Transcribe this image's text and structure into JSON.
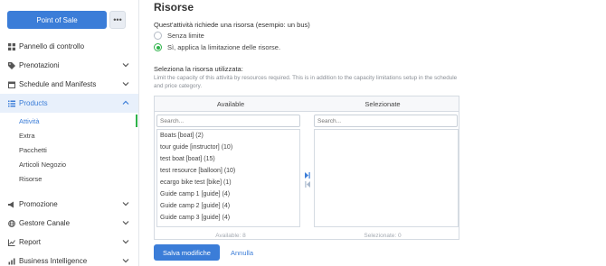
{
  "sidebar": {
    "pos_label": "Point of Sale",
    "more_label": "•••",
    "items": [
      {
        "label": "Pannello di controllo",
        "icon": "grid-icon",
        "chevron": false
      },
      {
        "label": "Prenotazioni",
        "icon": "tag-icon",
        "chevron": true
      },
      {
        "label": "Schedule and Manifests",
        "icon": "calendar-icon",
        "chevron": true
      },
      {
        "label": "Products",
        "icon": "list-icon",
        "chevron": true,
        "active": true
      },
      {
        "label": "Promozione",
        "icon": "megaphone-icon",
        "chevron": true
      },
      {
        "label": "Gestore Canale",
        "icon": "globe-icon",
        "chevron": true
      },
      {
        "label": "Report",
        "icon": "chart-icon",
        "chevron": true
      },
      {
        "label": "Business Intelligence",
        "icon": "intelligence-icon",
        "chevron": true
      }
    ],
    "sub_items": [
      "Attività",
      "Extra",
      "Pacchetti",
      "Articoli Negozio",
      "Risorse"
    ]
  },
  "page": {
    "title": "Risorse",
    "question": "Quest'attività richiede una risorsa (esempio: un bus)",
    "radio_options": [
      {
        "label": "Senza limite",
        "selected": false
      },
      {
        "label": "Sì, applica la limitazione delle risorse.",
        "selected": true
      }
    ],
    "select_label": "Seleziona la risorsa utilizzata:",
    "select_help": "Limit the capacity of this attività by resources required. This is in addition to the capacity limitations setup in the schedule and price category."
  },
  "dual_list": {
    "available_header": "Available",
    "selected_header": "Selezionate",
    "search_placeholder": "Search...",
    "available_items": [
      "Boats [boat] (2)",
      "tour guide [instructor] (10)",
      "test boat [boat] (15)",
      "test resource [balloon] (10)",
      "ecargo bike test [bike] (1)",
      "Guide camp 1 [guide] (4)",
      "Guide camp 2 [guide] (4)",
      "Guide camp 3 [guide] (4)"
    ],
    "available_footer": "Available: 8",
    "selected_footer": "Selezionate: 0"
  },
  "actions": {
    "save_label": "Salva modifiche",
    "cancel_label": "Annulla"
  },
  "colors": {
    "primary": "#3b7dd8",
    "accent_green": "#2eb34a"
  }
}
